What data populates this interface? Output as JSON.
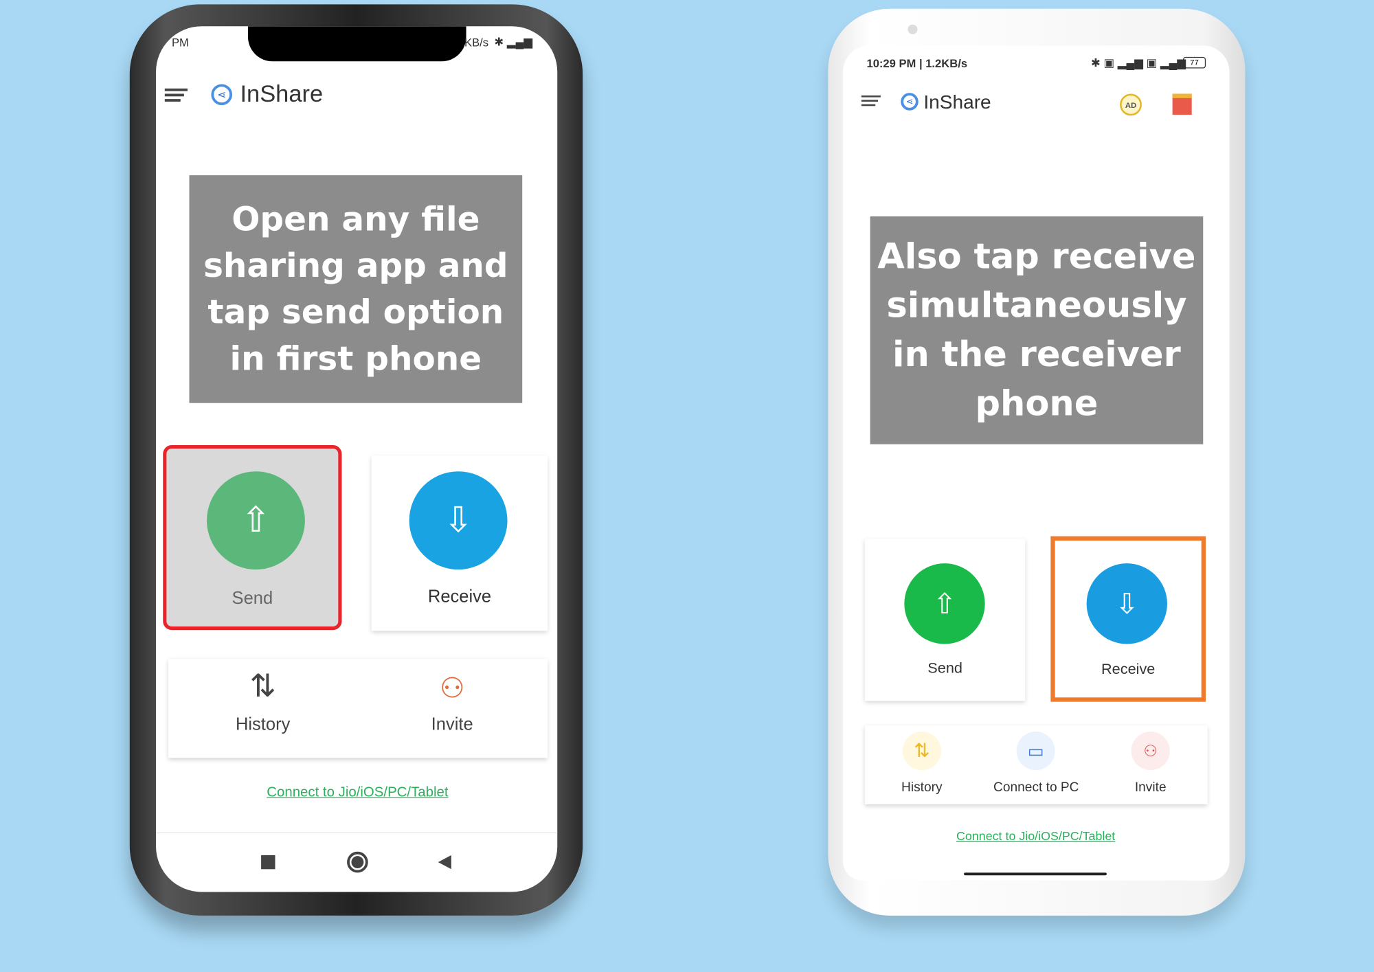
{
  "phone1": {
    "status_left": "PM",
    "status_right": "KB/s",
    "app_title": "InShare",
    "overlay_text": "Open any file sharing app and tap send option in first phone",
    "send_label": "Send",
    "receive_label": "Receive",
    "history_label": "History",
    "invite_label": "Invite",
    "connect_link": "Connect to Jio/iOS/PC/Tablet",
    "highlight_color": "#e8232a"
  },
  "phone2": {
    "status_left": "10:29 PM | 1.2KB/s",
    "battery": "77",
    "app_title": "InShare",
    "overlay_text": "Also tap receive simultaneously in the receiver phone",
    "send_label": "Send",
    "receive_label": "Receive",
    "history_label": "History",
    "connect_pc_label": "Connect to PC",
    "invite_label": "Invite",
    "connect_link": "Connect to Jio/iOS/PC/Tablet",
    "highlight_color": "#f07b2d"
  }
}
